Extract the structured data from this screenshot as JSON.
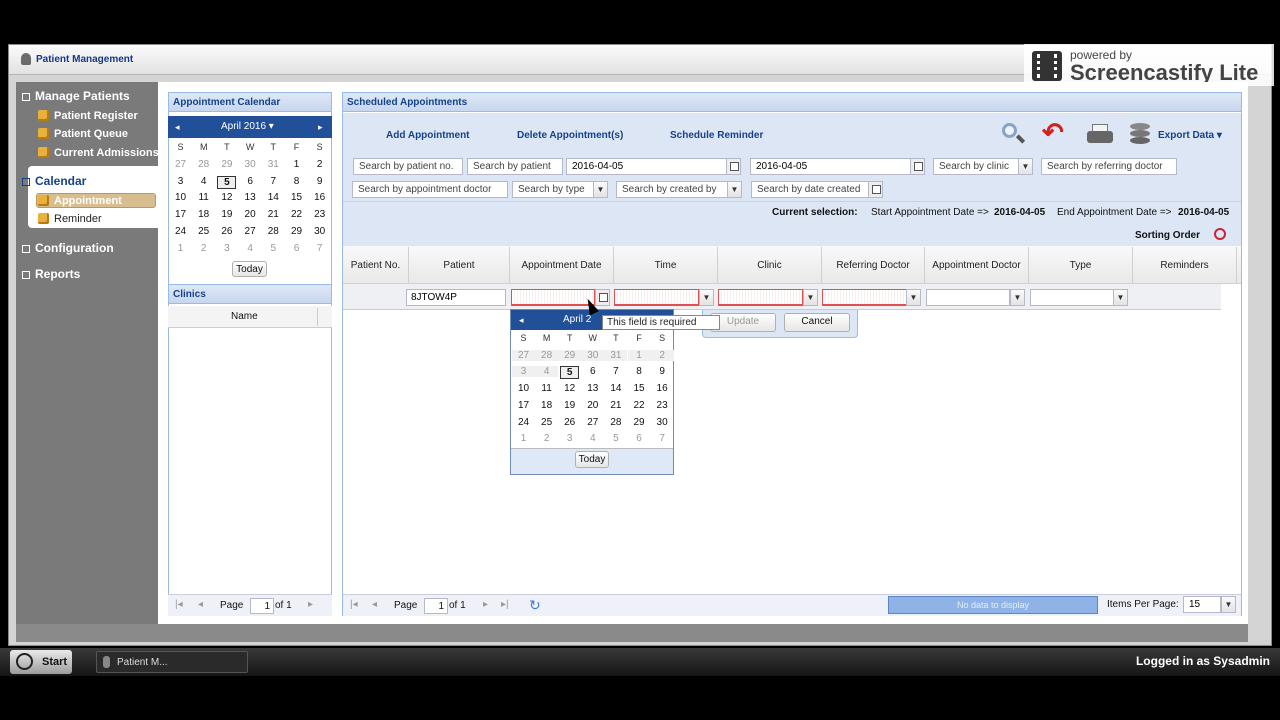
{
  "window": {
    "title": "Patient Management"
  },
  "watermark": {
    "line1": "powered by",
    "line2": "Screencastify Lite"
  },
  "nav": {
    "manage": "Manage Patients",
    "items1": [
      "Patient Register",
      "Patient Queue",
      "Current Admissions"
    ],
    "calendar": "Calendar",
    "items2": [
      "Appointment",
      "Reminder"
    ],
    "configuration": "Configuration",
    "reports": "Reports"
  },
  "left_panel": {
    "title": "Appointment Calendar",
    "month": "April 2016",
    "dow": [
      "S",
      "M",
      "T",
      "W",
      "T",
      "F",
      "S"
    ],
    "weeks": [
      [
        "27",
        "28",
        "29",
        "30",
        "31",
        "1",
        "2"
      ],
      [
        "3",
        "4",
        "5",
        "6",
        "7",
        "8",
        "9"
      ],
      [
        "10",
        "11",
        "12",
        "13",
        "14",
        "15",
        "16"
      ],
      [
        "17",
        "18",
        "19",
        "20",
        "21",
        "22",
        "23"
      ],
      [
        "24",
        "25",
        "26",
        "27",
        "28",
        "29",
        "30"
      ],
      [
        "1",
        "2",
        "3",
        "4",
        "5",
        "6",
        "7"
      ]
    ],
    "today": "Today",
    "clinics_title": "Clinics",
    "clinics_col": "Name",
    "pager": {
      "page": "Page",
      "num": "1",
      "of": "of 1"
    }
  },
  "sched": {
    "title": "Scheduled Appointments",
    "toolbar": {
      "add": "Add Appointment",
      "delete": "Delete Appointment(s)",
      "reminder": "Schedule Reminder",
      "export": "Export Data"
    },
    "filters": {
      "patient_no": "Search by patient no.",
      "patient": "Search by patient",
      "date_from": "2016-04-05",
      "date_to": "2016-04-05",
      "clinic": "Search by clinic",
      "ref_doc": "Search by referring doctor",
      "appt_doc": "Search by appointment doctor",
      "type": "Search by type",
      "created_by": "Search by created by",
      "date_created": "Search by date created"
    },
    "current": {
      "label": "Current selection:",
      "start": "Start Appointment Date =>",
      "start_val": "2016-04-05",
      "end": "End Appointment Date =>",
      "end_val": "2016-04-05"
    },
    "sorting": "Sorting Order",
    "columns": [
      "Patient No.",
      "Patient",
      "Appointment Date",
      "Time",
      "Clinic",
      "Referring Doctor",
      "Appointment Doctor",
      "Type",
      "Reminders"
    ],
    "edit": {
      "patient": "8JTOW4P",
      "update": "Update",
      "cancel": "Cancel"
    },
    "tooltip": "This field is required",
    "popup": {
      "month": "April 2",
      "dow": [
        "S",
        "M",
        "T",
        "W",
        "T",
        "F",
        "S"
      ],
      "weeks": [
        [
          "27",
          "28",
          "29",
          "30",
          "31",
          "1",
          "2"
        ],
        [
          "3",
          "4",
          "5",
          "6",
          "7",
          "8",
          "9"
        ],
        [
          "10",
          "11",
          "12",
          "13",
          "14",
          "15",
          "16"
        ],
        [
          "17",
          "18",
          "19",
          "20",
          "21",
          "22",
          "23"
        ],
        [
          "24",
          "25",
          "26",
          "27",
          "28",
          "29",
          "30"
        ],
        [
          "1",
          "2",
          "3",
          "4",
          "5",
          "6",
          "7"
        ]
      ],
      "today": "Today"
    },
    "pager": {
      "page": "Page",
      "num": "1",
      "of": "of 1",
      "nodata": "No data to display",
      "ipp_label": "Items Per Page:",
      "ipp": "15"
    }
  },
  "taskbar": {
    "start": "Start",
    "task": "Patient M...",
    "logged": "Logged in as Sysadmin"
  }
}
